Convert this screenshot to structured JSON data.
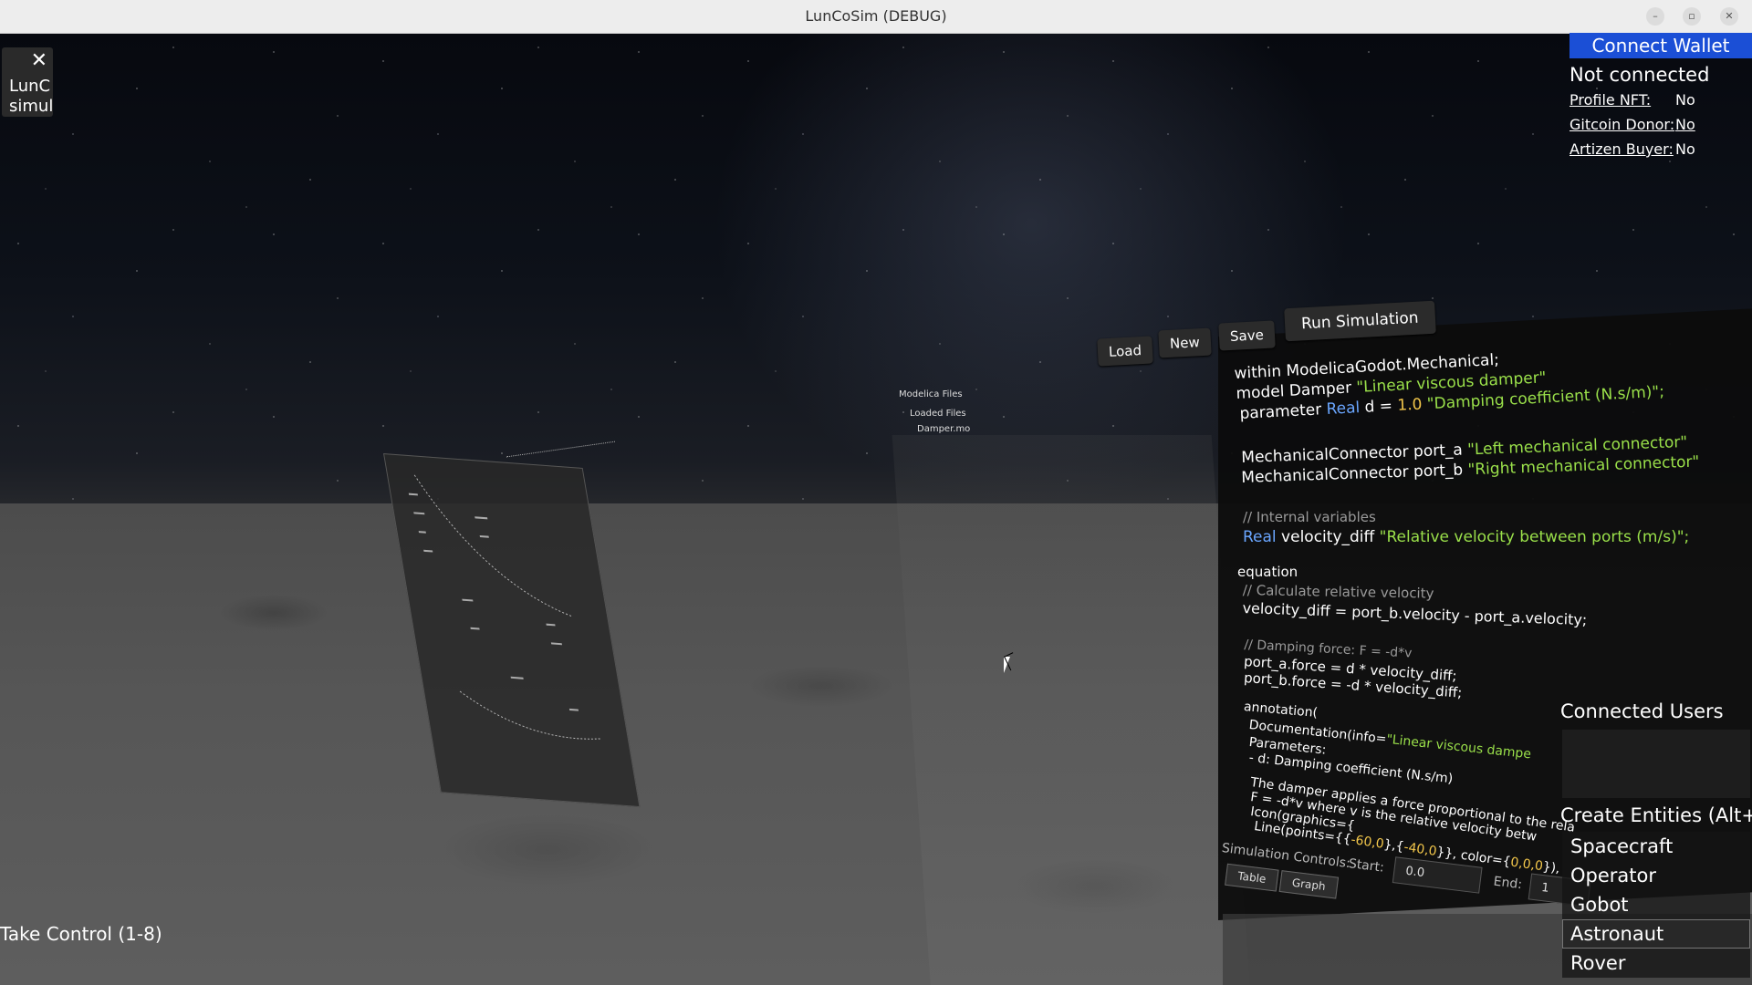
{
  "window": {
    "title": "LunCoSim (DEBUG)"
  },
  "mini_panel": {
    "close": "✕",
    "line1": "LunC",
    "line2": "simul"
  },
  "wallet": {
    "connect_label": "Connect Wallet",
    "status": "Not connected",
    "profile_nft_label": "Profile NFT:",
    "profile_nft_value": "No",
    "gitcoin_label": "Gitcoin Donor:",
    "gitcoin_value": "No",
    "artizen_label": "Artizen Buyer:",
    "artizen_value": "No"
  },
  "file_panel": {
    "title": "Modelica Files",
    "loaded_label": "Loaded Files",
    "file": "Damper.mo"
  },
  "toolbar": {
    "load": "Load",
    "new": "New",
    "save": "Save",
    "run": "Run Simulation"
  },
  "code": {
    "l1": "within ModelicaGodot.Mechanical;",
    "l2a": "model Damper ",
    "l2b": "\"Linear viscous damper\"",
    "l3a": "parameter ",
    "l3b": "Real",
    "l3c": " d = ",
    "l3d": "1.0",
    "l3e": " \"Damping coefficient (N.s/m)\";",
    "l4a": "MechanicalConnector port_a ",
    "l4b": "\"Left mechanical connector\"",
    "l5a": "MechanicalConnector port_b ",
    "l5b": "\"Right mechanical connector\"",
    "l6": "// Internal variables",
    "l7a": "Real",
    "l7b": " velocity_diff ",
    "l7c": "\"Relative velocity between ports (m/s)\";",
    "l8": "equation",
    "l9": "// Calculate relative velocity",
    "l10": "velocity_diff = port_b.velocity - port_a.velocity;",
    "l11": "// Damping force: F = -d*v",
    "l12": "port_a.force = d * velocity_diff;",
    "l13": "port_b.force = -d * velocity_diff;",
    "l14": "annotation(",
    "l15a": "Documentation(info=",
    "l15b": "\"Linear viscous dampe",
    "l16": "Parameters:",
    "l17": "- d: Damping coefficient (N.s/m)",
    "l18": "The damper applies a force proportional to the rela",
    "l19": "F = -d*v where v is the relative velocity betw",
    "l20": "Icon(graphics={",
    "l21a": "Line(points={{",
    "l21b": "-60,0",
    "l21c": "},{",
    "l21d": "-40,0",
    "l21e": "}}, color={",
    "l21f": "0,0,0",
    "l21g": "}),"
  },
  "sim_controls": {
    "label": "Simulation Controls:",
    "start_label": "Start:",
    "start_value": "0.0",
    "end_label": "End:",
    "end_value": "1",
    "tab_table": "Table",
    "tab_graph": "Graph"
  },
  "connected_users": {
    "title": "Connected Users"
  },
  "create_entities": {
    "title": "Create Entities (Alt+#)",
    "items": [
      "Spacecraft",
      "Operator",
      "Gobot",
      "Astronaut",
      "Rover"
    ],
    "selected": "Astronaut"
  },
  "take_control": "Take Control (1-8)"
}
